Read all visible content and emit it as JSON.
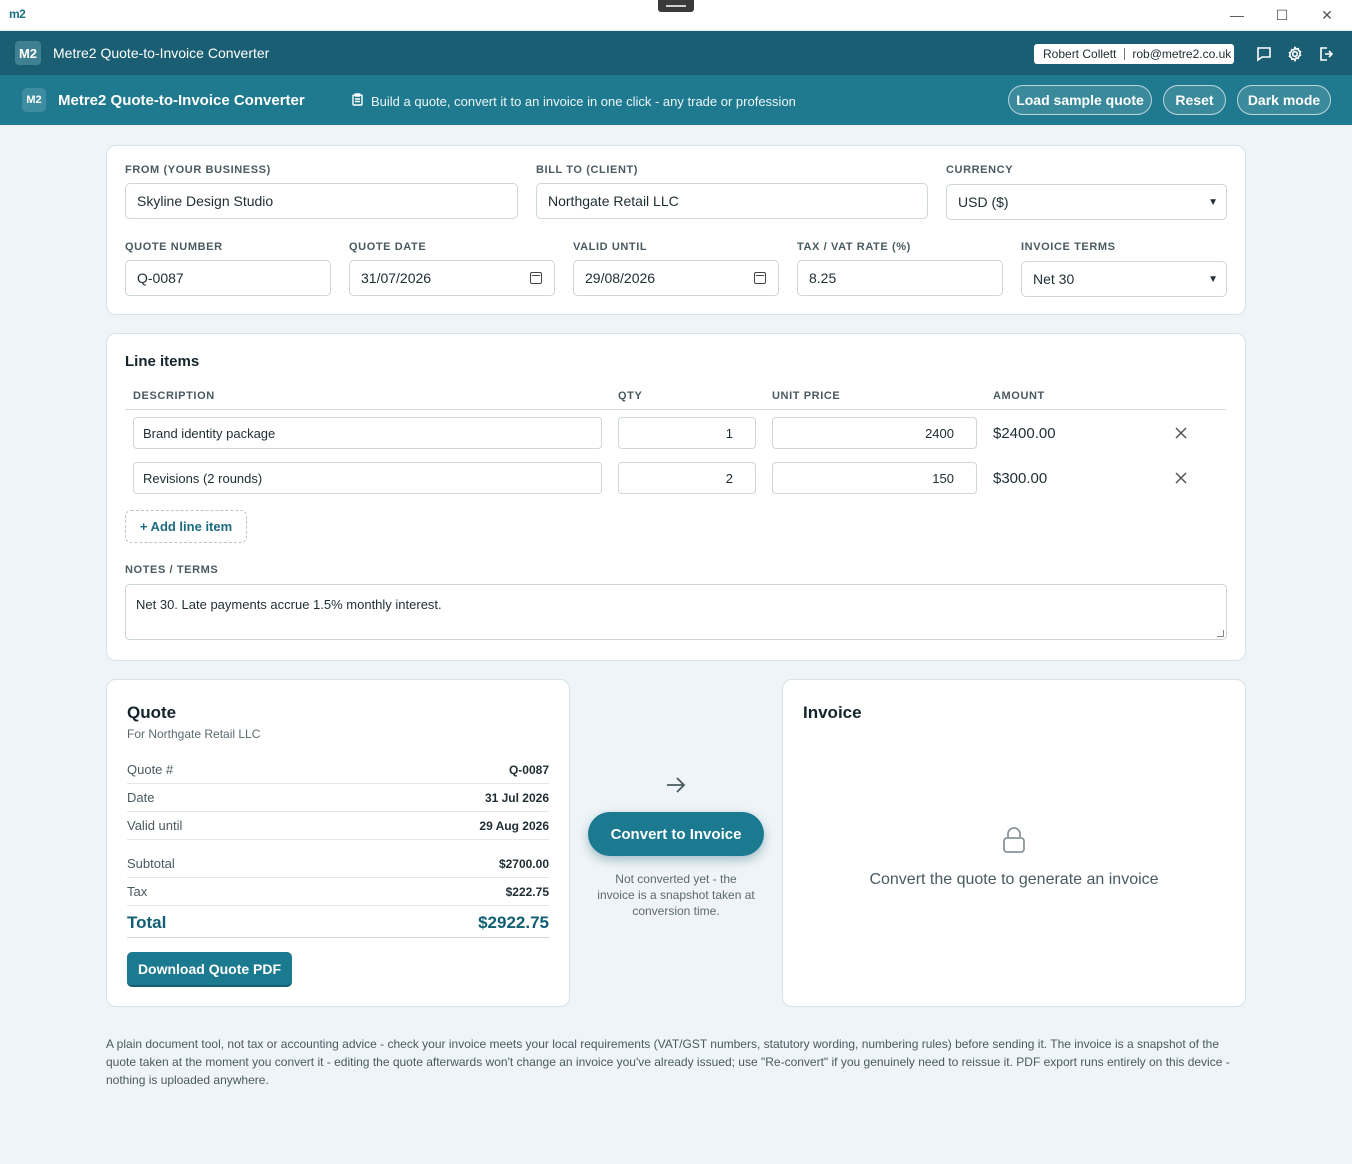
{
  "window": {
    "logo": "m2",
    "minimize": "—",
    "maximize": "☐",
    "close": "✕"
  },
  "appbar": {
    "badge": "M2",
    "title": "Metre2 Quote-to-Invoice Converter",
    "user_name": "Robert Collett",
    "user_email": "rob@metre2.co.uk"
  },
  "toolbar": {
    "badge": "M2",
    "title": "Metre2 Quote-to-Invoice Converter",
    "tagline": "Build a quote, convert it to an invoice in one click - any trade or profession",
    "load_sample": "Load sample quote",
    "reset": "Reset",
    "dark_mode": "Dark mode"
  },
  "form": {
    "from_label": "FROM (YOUR BUSINESS)",
    "from_value": "Skyline Design Studio",
    "bill_to_label": "BILL TO (CLIENT)",
    "bill_to_value": "Northgate Retail LLC",
    "currency_label": "CURRENCY",
    "currency_value": "USD ($)",
    "quote_number_label": "QUOTE NUMBER",
    "quote_number_value": "Q-0087",
    "quote_date_label": "QUOTE DATE",
    "quote_date_value": "31/07/2026",
    "valid_until_label": "VALID UNTIL",
    "valid_until_value": "29/08/2026",
    "tax_label": "TAX / VAT RATE (%)",
    "tax_value": "8.25",
    "terms_label": "INVOICE TERMS",
    "terms_value": "Net 30"
  },
  "line_items": {
    "title": "Line items",
    "headers": {
      "description": "DESCRIPTION",
      "qty": "QTY",
      "unit_price": "UNIT PRICE",
      "amount": "AMOUNT"
    },
    "rows": [
      {
        "description": "Brand identity package",
        "qty": "1",
        "unit_price": "2400",
        "amount": "$2400.00"
      },
      {
        "description": "Revisions (2 rounds)",
        "qty": "2",
        "unit_price": "150",
        "amount": "$300.00"
      }
    ],
    "add_label": "+ Add line item",
    "notes_label": "NOTES / TERMS",
    "notes_value": "Net 30. Late payments accrue 1.5% monthly interest."
  },
  "quote": {
    "title": "Quote",
    "subtitle": "For Northgate Retail LLC",
    "rows": [
      {
        "k": "Quote #",
        "v": "Q-0087"
      },
      {
        "k": "Date",
        "v": "31 Jul 2026"
      },
      {
        "k": "Valid until",
        "v": "29 Aug 2026"
      },
      {
        "k": "Subtotal",
        "v": "$2700.00"
      },
      {
        "k": "Tax",
        "v": "$222.75"
      }
    ],
    "total_label": "Total",
    "total_value": "$2922.75",
    "download_label": "Download Quote PDF"
  },
  "convert": {
    "button": "Convert to Invoice",
    "note": "Not converted yet - the invoice is a snapshot taken at conversion time."
  },
  "invoice": {
    "title": "Invoice",
    "empty": "Convert the quote to generate an invoice"
  },
  "footer": "A plain document tool, not tax or accounting advice - check your invoice meets your local requirements (VAT/GST numbers, statutory wording, numbering rules) before sending it. The invoice is a snapshot of the quote taken at the moment you convert it - editing the quote afterwards won't change an invoice you've already issued; use \"Re-convert\" if you genuinely need to reissue it. PDF export runs entirely on this device - nothing is uploaded anywhere.",
  "colors": {
    "appbar": "#1a5e73",
    "toolbar": "#207a8f",
    "accent": "#1b7a90",
    "background": "#eef4f7"
  }
}
